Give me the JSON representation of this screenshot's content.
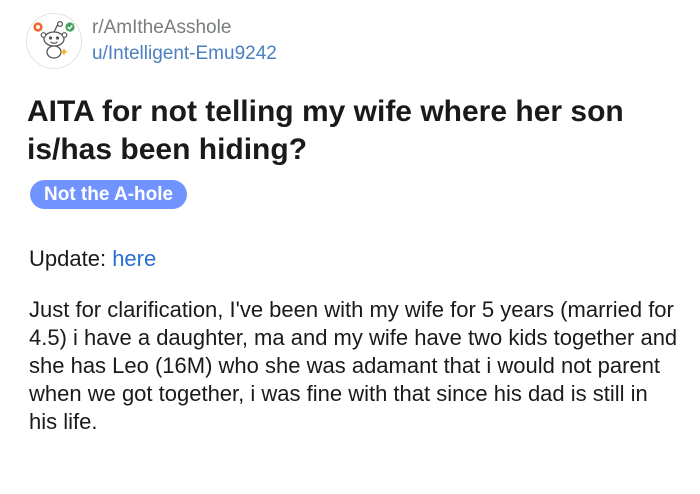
{
  "post": {
    "subreddit": "r/AmItheAsshole",
    "author": "u/Intelligent-Emu9242",
    "avatar_icon": "snoo-avatar-icon",
    "title": "AITA for not telling my wife where her son is/has been hiding?",
    "flair": "Not the A-hole",
    "flair_color": "#7193ff",
    "update_label": "Update:",
    "update_link": "here",
    "body": "Just for clarification, I've been with my wife for 5 years (married for 4.5) i have a daughter, ma and my wife have two kids together and she has Leo (16M) who she was adamant that i would not parent when we got together, i was fine with that since his dad is still in his life."
  }
}
